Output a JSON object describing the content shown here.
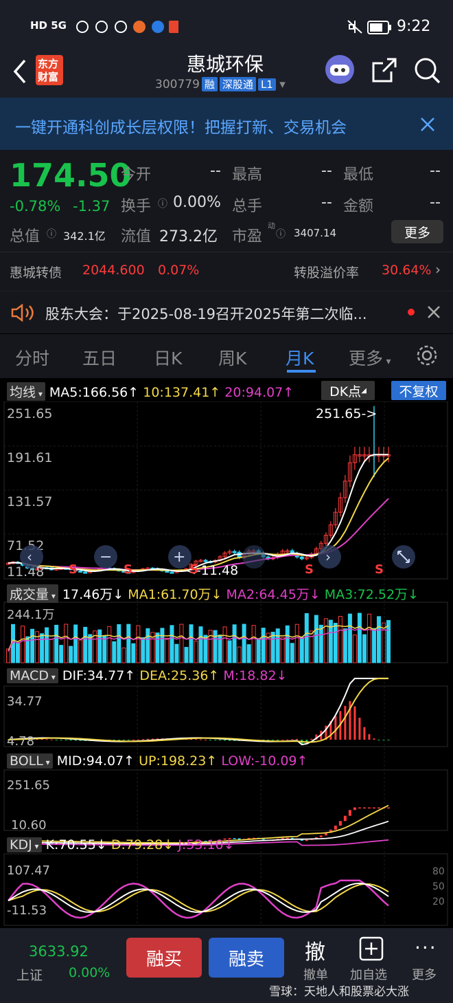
{
  "status": {
    "time": "9:22",
    "network": "HD 5G",
    "battery": "battery"
  },
  "header": {
    "logo_line1": "东方",
    "logo_line2": "财富",
    "title": "惠城环保",
    "code": "300779",
    "tag_rong": "融",
    "tag_sgt": "深股通",
    "tag_l1": "L1"
  },
  "banner": {
    "text": "一键开通科创成长层权限！把握打新、交易机会"
  },
  "quote": {
    "price": "174.50",
    "change_pct": "-0.78%",
    "change": "-1.37",
    "open_label": "今开",
    "open_value": "--",
    "high_label": "最高",
    "high_value": "--",
    "low_label": "最低",
    "low_value": "--",
    "turnover_label": "换手",
    "turnover_value": "0.00%",
    "volume_label": "总手",
    "volume_value": "--",
    "amount_label": "金额",
    "amount_value": "--",
    "mktcap_label": "总值",
    "mktcap_value": "342.1亿",
    "float_label": "流值",
    "float_value": "273.2亿",
    "pe_label": "市盈",
    "pe_sup": "动",
    "pe_value": "3407.14",
    "more_label": "更多",
    "bond_name": "惠城转债",
    "bond_price": "2044.600",
    "bond_pct": "0.07%",
    "premium_label": "转股溢价率",
    "premium_value": "30.64%"
  },
  "notice": {
    "text": "股东大会：于2025-08-19召开2025年第二次临..."
  },
  "tabs": [
    "分时",
    "五日",
    "日K",
    "周K",
    "月K",
    "更多"
  ],
  "active_tab": "月K",
  "ma": {
    "label": "均线",
    "ma5": "MA5:166.56",
    "ma10": "10:137.41",
    "ma20": "20:94.07",
    "dk": "DK点",
    "fq": "不复权"
  },
  "kline": {
    "y1": "251.65",
    "y2": "191.61",
    "y3": "131.57",
    "y4": "71.52",
    "y5": "11.48",
    "max_label": "251.65->",
    "min_label": "<-11.48",
    "s_marker": "S"
  },
  "vol": {
    "label": "成交量",
    "v": "17.46万",
    "ma1": "MA1:61.70万",
    "ma2": "MA2:64.45万",
    "ma3": "MA3:72.52万",
    "ymax": "244.1万"
  },
  "macd": {
    "label": "MACD",
    "dif": "DIF:34.77",
    "dea": "DEA:25.36",
    "m": "M:18.82",
    "y1": "34.77",
    "y2": "4.78"
  },
  "boll": {
    "label": "BOLL",
    "mid": "MID:94.07",
    "up": "UP:198.23",
    "low": "LOW:-10.09",
    "y1": "251.65",
    "y2": "10.60"
  },
  "kdj": {
    "label": "KDJ",
    "k": "K:70.55",
    "d": "D:79.28",
    "j": "J:53.10",
    "y1": "107.47",
    "y2": "-11.53",
    "r80": "80",
    "r50": "50",
    "r20": "20"
  },
  "bottom": {
    "index_value": "3633.92",
    "index_name": "上证",
    "index_pct": "0.00%",
    "buy": "融买",
    "sell": "融卖",
    "cancel": "撤单",
    "cancel_icon": "撤",
    "watch": "加自选",
    "more": "更多",
    "watermark": "雪球：天地人和股票必大涨"
  },
  "colors": {
    "up": "#ff3b3b",
    "down": "#19c24c",
    "accent": "#2a6fd1",
    "ma5": "#ffffff",
    "ma10": "#f5d94a",
    "ma20": "#e040c8"
  }
}
